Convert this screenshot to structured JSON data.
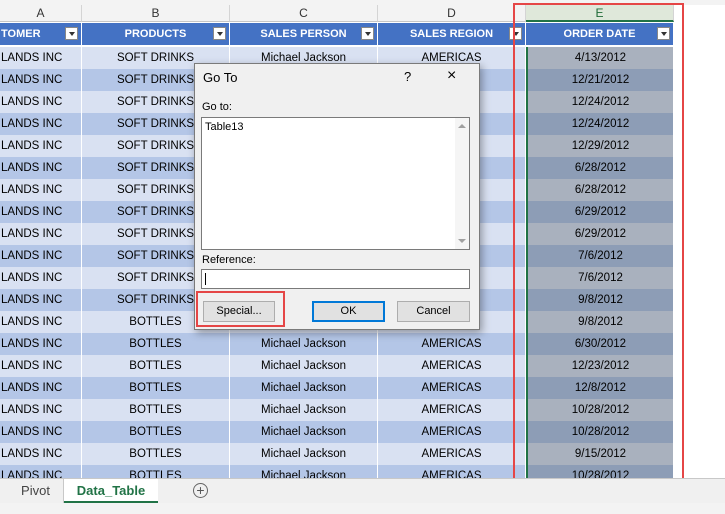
{
  "columns": [
    {
      "letter": "A",
      "header": "TOMER",
      "width": 82
    },
    {
      "letter": "B",
      "header": "PRODUCTS",
      "width": 148
    },
    {
      "letter": "C",
      "header": "SALES PERSON",
      "width": 148
    },
    {
      "letter": "D",
      "header": "SALES REGION",
      "width": 148
    },
    {
      "letter": "E",
      "header": "ORDER DATE",
      "width": 148
    }
  ],
  "rows": [
    [
      "LANDS INC",
      "SOFT DRINKS",
      "Michael Jackson",
      "AMERICAS",
      "4/13/2012"
    ],
    [
      "LANDS INC",
      "SOFT DRINKS",
      "",
      "",
      "12/21/2012"
    ],
    [
      "LANDS INC",
      "SOFT DRINKS",
      "",
      "",
      "12/24/2012"
    ],
    [
      "LANDS INC",
      "SOFT DRINKS",
      "",
      "",
      "12/24/2012"
    ],
    [
      "LANDS INC",
      "SOFT DRINKS",
      "",
      "",
      "12/29/2012"
    ],
    [
      "LANDS INC",
      "SOFT DRINKS",
      "",
      "",
      "6/28/2012"
    ],
    [
      "LANDS INC",
      "SOFT DRINKS",
      "",
      "",
      "6/28/2012"
    ],
    [
      "LANDS INC",
      "SOFT DRINKS",
      "",
      "",
      "6/29/2012"
    ],
    [
      "LANDS INC",
      "SOFT DRINKS",
      "",
      "",
      "6/29/2012"
    ],
    [
      "LANDS INC",
      "SOFT DRINKS",
      "",
      "",
      "7/6/2012"
    ],
    [
      "LANDS INC",
      "SOFT DRINKS",
      "",
      "",
      "7/6/2012"
    ],
    [
      "LANDS INC",
      "SOFT DRINKS",
      "",
      "",
      "9/8/2012"
    ],
    [
      "LANDS INC",
      "BOTTLES",
      "",
      "",
      "9/8/2012"
    ],
    [
      "LANDS INC",
      "BOTTLES",
      "Michael Jackson",
      "AMERICAS",
      "6/30/2012"
    ],
    [
      "LANDS INC",
      "BOTTLES",
      "Michael Jackson",
      "AMERICAS",
      "12/23/2012"
    ],
    [
      "LANDS INC",
      "BOTTLES",
      "Michael Jackson",
      "AMERICAS",
      "12/8/2012"
    ],
    [
      "LANDS INC",
      "BOTTLES",
      "Michael Jackson",
      "AMERICAS",
      "10/28/2012"
    ],
    [
      "LANDS INC",
      "BOTTLES",
      "Michael Jackson",
      "AMERICAS",
      "10/28/2012"
    ],
    [
      "LANDS INC",
      "BOTTLES",
      "Michael Jackson",
      "AMERICAS",
      "9/15/2012"
    ],
    [
      "LANDS INC",
      "BOTTLES",
      "Michael Jackson",
      "AMERICAS",
      "10/28/2012"
    ]
  ],
  "sheet_tabs": [
    "Pivot",
    "Data_Table"
  ],
  "active_tab": "Data_Table",
  "add_sheet_symbol": "+",
  "dialog": {
    "title": "Go To",
    "help": "?",
    "close": "×",
    "goto_label": "Go to:",
    "list_items": [
      "Table13"
    ],
    "reference_label": "Reference:",
    "reference_value": "",
    "special_button": "Special...",
    "ok_button": "OK",
    "cancel_button": "Cancel"
  },
  "colors": {
    "header_blue": "#4472c4",
    "band_light": "#d9e1f2",
    "band_dark": "#b4c6e7",
    "selected_column": "#8d9db6",
    "highlight_red": "#e54646",
    "excel_green": "#217346"
  }
}
